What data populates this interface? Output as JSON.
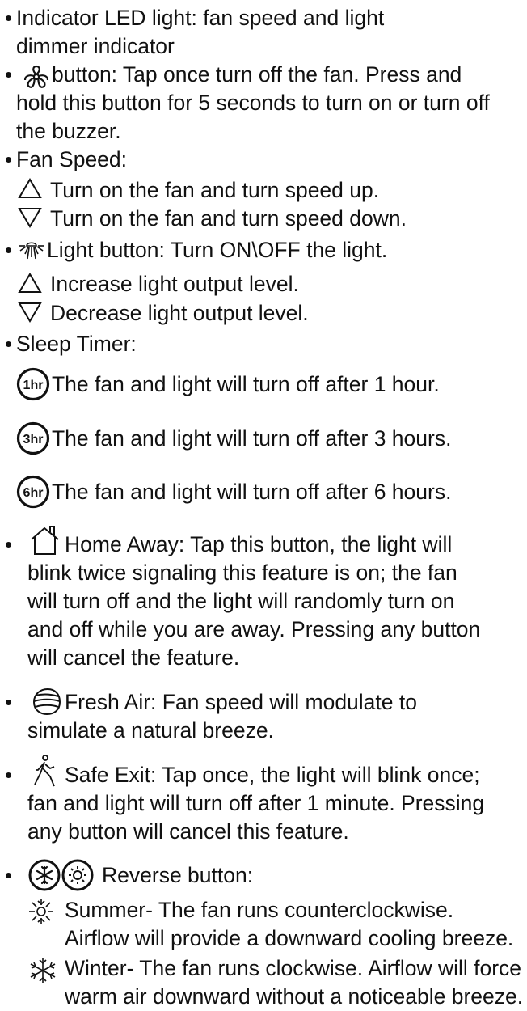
{
  "items": {
    "indicator": {
      "bullet": "•",
      "lines": [
        "Indicator LED light: fan speed and light",
        "dimmer indicator"
      ],
      "icon": "none"
    },
    "power": {
      "bullet": "•",
      "icon": "fan-power-icon",
      "lines": [
        "button: Tap once turn off the fan. Press and",
        "hold this button for 5 seconds to turn on or turn off",
        "the buzzer."
      ]
    },
    "fan_speed": {
      "bullet": "•",
      "title": "Fan Speed:",
      "up": {
        "icon": "triangle-up-icon",
        "text": "Turn on the fan and turn speed up."
      },
      "down": {
        "icon": "triangle-down-icon",
        "text": "Turn on the fan and  turn speed down."
      }
    },
    "light": {
      "bullet": "•",
      "icon": "light-bulb-icon",
      "text": "Light button: Turn ON\\OFF the light.",
      "up": {
        "icon": "triangle-up-icon",
        "text": "Increase light output level."
      },
      "down": {
        "icon": "triangle-down-icon",
        "text": "Decrease light output level."
      }
    },
    "sleep_timer": {
      "bullet": "•",
      "title": "Sleep Timer:",
      "options": [
        {
          "icon_label": "1hr",
          "text": "The fan and light will turn off after 1 hour."
        },
        {
          "icon_label": "3hr",
          "text": "The fan and light will turn off after 3 hours."
        },
        {
          "icon_label": "6hr",
          "text": "The fan and light will turn off after 6 hours."
        }
      ]
    },
    "home_away": {
      "bullet": "•",
      "icon": "home-icon",
      "lines": [
        "Home Away: Tap this button, the light will",
        "blink twice signaling this feature is on; the fan",
        "will turn off and the light will randomly turn on",
        "and off while you are away. Pressing any button",
        "will cancel the feature."
      ]
    },
    "fresh_air": {
      "bullet": "•",
      "icon": "fresh-air-icon",
      "lines": [
        "Fresh Air: Fan speed will modulate to",
        "simulate a natural breeze."
      ]
    },
    "safe_exit": {
      "bullet": "•",
      "icon": "walking-person-icon",
      "lines": [
        "Safe Exit: Tap once, the light will blink once;",
        "fan and light will turn off after 1 minute. Pressing",
        "any button will cancel this feature."
      ]
    },
    "reverse": {
      "bullet": "•",
      "icons": [
        "winter-snowflake-icon",
        "summer-sun-icon"
      ],
      "text": "Reverse button:",
      "summer": {
        "icon": "summer-sun-icon",
        "lines": [
          "Summer- The fan runs counterclockwise.",
          "Airflow will provide a downward cooling breeze."
        ]
      },
      "winter": {
        "icon": "winter-snowflake-icon",
        "lines": [
          "Winter- The fan runs clockwise. Airflow will force",
          "warm air downward without a noticeable breeze."
        ]
      }
    }
  }
}
